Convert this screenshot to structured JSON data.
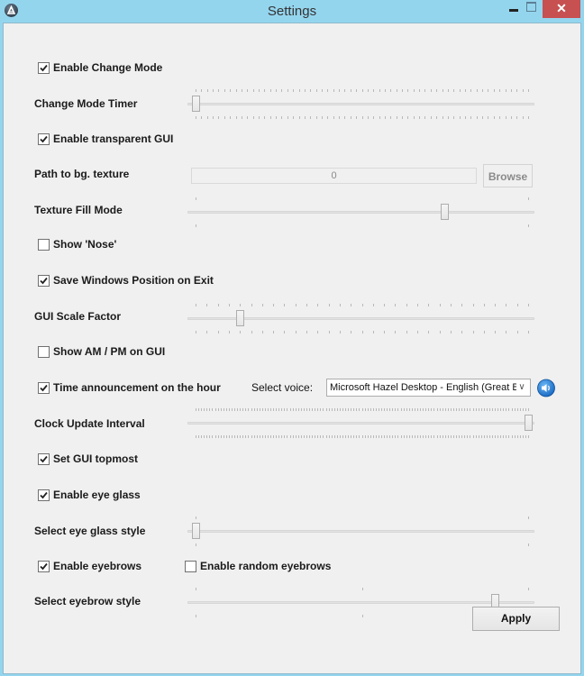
{
  "window": {
    "title": "Settings",
    "app_icon": "autoit-icon",
    "controls": {
      "minimize": "–",
      "maximize": "□",
      "close": "✕"
    }
  },
  "settings": {
    "enable_change_mode": {
      "label": "Enable Change Mode",
      "checked": true
    },
    "change_mode_timer": {
      "label": "Change Mode Timer",
      "value_fraction": 0.0,
      "ticks": 59
    },
    "enable_transparent_gui": {
      "label": "Enable transparent GUI",
      "checked": true
    },
    "path_to_bg_texture": {
      "label": "Path to bg. texture",
      "value": "0",
      "browse_label": "Browse"
    },
    "texture_fill_mode": {
      "label": "Texture Fill Mode",
      "value_fraction": 0.75,
      "ticks": 2
    },
    "show_nose": {
      "label": "Show 'Nose'",
      "checked": false
    },
    "save_windows_position": {
      "label": "Save Windows Position on Exit",
      "checked": true
    },
    "gui_scale_factor": {
      "label": "GUI Scale Factor",
      "value_fraction": 0.1333,
      "ticks": 31
    },
    "show_am_pm": {
      "label": "Show AM / PM on GUI",
      "checked": false
    },
    "time_announcement": {
      "label": "Time announcement on the hour",
      "checked": true
    },
    "select_voice": {
      "label": "Select voice:",
      "value": "Microsoft Hazel Desktop - English (Great Brit",
      "speaker_icon": "speaker-icon"
    },
    "clock_update_interval": {
      "label": "Clock Update Interval",
      "value_fraction": 1.0,
      "ticks": 121
    },
    "set_gui_topmost": {
      "label": "Set GUI topmost",
      "checked": true
    },
    "enable_eye_glass": {
      "label": "Enable eye glass",
      "checked": true
    },
    "select_eye_glass_style": {
      "label": "Select eye glass style",
      "value_fraction": 0.0,
      "ticks": 2
    },
    "enable_eyebrows": {
      "label": "Enable eyebrows",
      "checked": true
    },
    "enable_random_eyebrows": {
      "label": "Enable random eyebrows",
      "checked": false
    },
    "select_eyebrow_style": {
      "label": "Select eyebrow style",
      "value_fraction": 0.9,
      "ticks": 3
    }
  },
  "footer": {
    "apply_label": "Apply"
  }
}
